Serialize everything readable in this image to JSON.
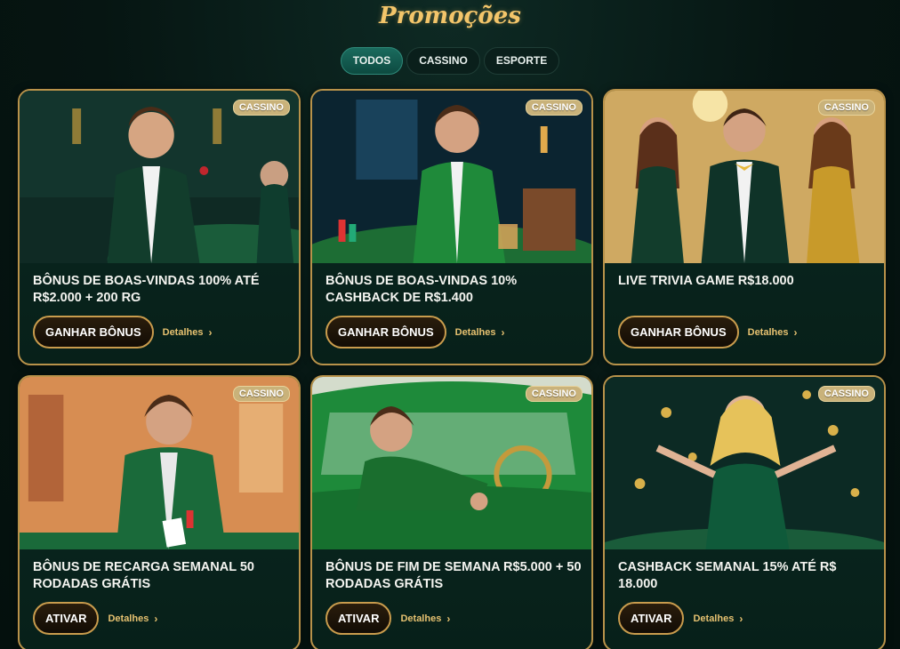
{
  "page": {
    "title": "Promoções"
  },
  "tabs": [
    {
      "label": "TODOS",
      "active": true
    },
    {
      "label": "CASSINO",
      "active": false
    },
    {
      "label": "ESPORTE",
      "active": false
    }
  ],
  "cards": [
    {
      "badge": "CASSINO",
      "title": "BÔNUS DE BOAS-VINDAS 100% ATÉ R$2.000 + 200 RG",
      "button": "GANHAR BÔNUS",
      "details": "Detalhes",
      "scene": "man-green-tuxedo-casino-table"
    },
    {
      "badge": "CASSINO",
      "title": "BÔNUS DE BOAS-VINDAS 10% CASHBACK DE R$1.400",
      "button": "GANHAR BÔNUS",
      "details": "Detalhes",
      "scene": "man-green-suit-roulette-table"
    },
    {
      "badge": "CASSINO",
      "title": "LIVE TRIVIA GAME R$18.000",
      "button": "GANHAR BÔNUS",
      "details": "Detalhes",
      "scene": "man-with-two-women-gold-hall"
    },
    {
      "badge": "CASSINO",
      "title": "BÔNUS DE RECARGA SEMANAL 50 RODADAS GRÁTIS",
      "button": "ATIVAR",
      "details": "Detalhes",
      "scene": "man-with-playing-cards"
    },
    {
      "badge": "CASSINO",
      "title": "BÔNUS DE FIM DE SEMANA R$5.000 + 50 RODADAS GRÁTIS",
      "button": "ATIVAR",
      "details": "Detalhes",
      "scene": "man-in-green-sports-car"
    },
    {
      "badge": "CASSINO",
      "title": "CASHBACK SEMANAL 15% ATÉ R$ 18.000",
      "button": "ATIVAR",
      "details": "Detalhes",
      "scene": "woman-with-falling-coins"
    }
  ],
  "colors": {
    "accent_gold": "#f3c56a",
    "card_border": "#b8924a",
    "tab_active": "#1a6b5e",
    "background": "#061512"
  }
}
